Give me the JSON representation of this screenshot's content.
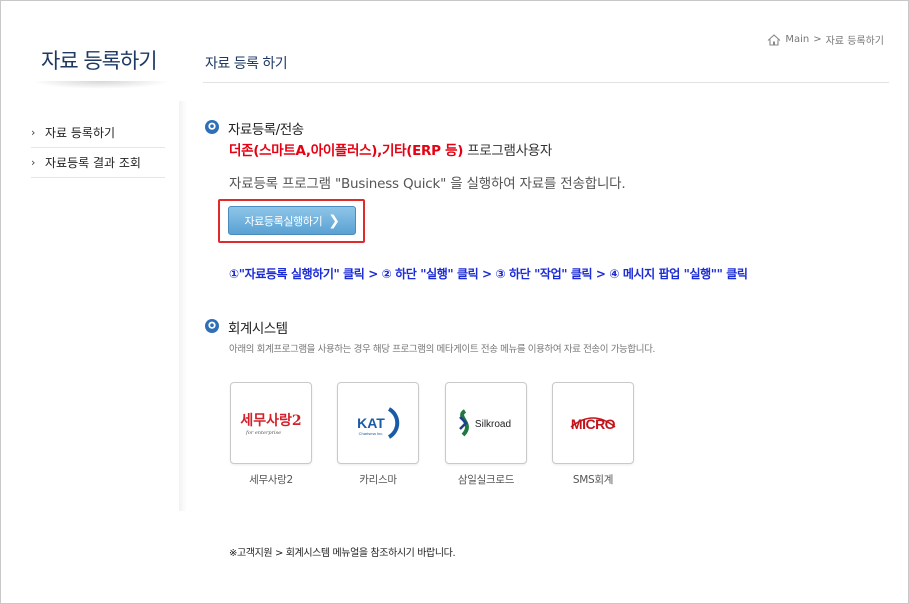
{
  "sidebar": {
    "title": "자료 등록하기",
    "items": [
      {
        "label": "자료 등록하기"
      },
      {
        "label": "자료등록 결과 조회"
      }
    ]
  },
  "header": {
    "page_title": "자료 등록 하기",
    "breadcrumb": {
      "home": "Main",
      "separator": ">",
      "current": "자료 등록하기"
    }
  },
  "section_upload": {
    "title": "자료등록/전송",
    "users_red": "더존(스마트A,아이플러스),기타(ERP 등)",
    "users_suffix": "프로그램사용자",
    "description": "자료등록 프로그램 \"Business Quick\" 을 실행하여 자료를 전송합니다.",
    "run_button_label": "자료등록실행하기",
    "steps": "①\"자료등록 실행하기\" 클릭 > ② 하단 \"실행\" 클릭 > ③ 하단 \"작업\" 클릭 > ④ 메시지 팝업 \"실행\"\" 클릭"
  },
  "section_accounting": {
    "title": "회계시스템",
    "description": "아래의 회계프로그램을 사용하는 경우 해당 프로그램의 메타게이트 전송 메뉴를 이용하여 자료 전송이 가능합니다.",
    "programs": [
      {
        "name": "세무사랑2",
        "logo_text": "세무사랑2",
        "logo_sub": "for enterprise"
      },
      {
        "name": "카리스마",
        "logo_text": "KAT",
        "logo_sub": "Charisma Inc."
      },
      {
        "name": "삼일실크로드",
        "logo_text": "Silkroad"
      },
      {
        "name": "SMS회계",
        "logo_text": "MICRO"
      }
    ]
  },
  "footnote": "※고객지원 > 회계시스템 메뉴얼을 참조하시기 바랍니다.",
  "colors": {
    "accent_blue": "#1e3a64",
    "red": "#e60012",
    "steps_blue": "#1b2bd6",
    "button_blue": "#6aaedb"
  }
}
